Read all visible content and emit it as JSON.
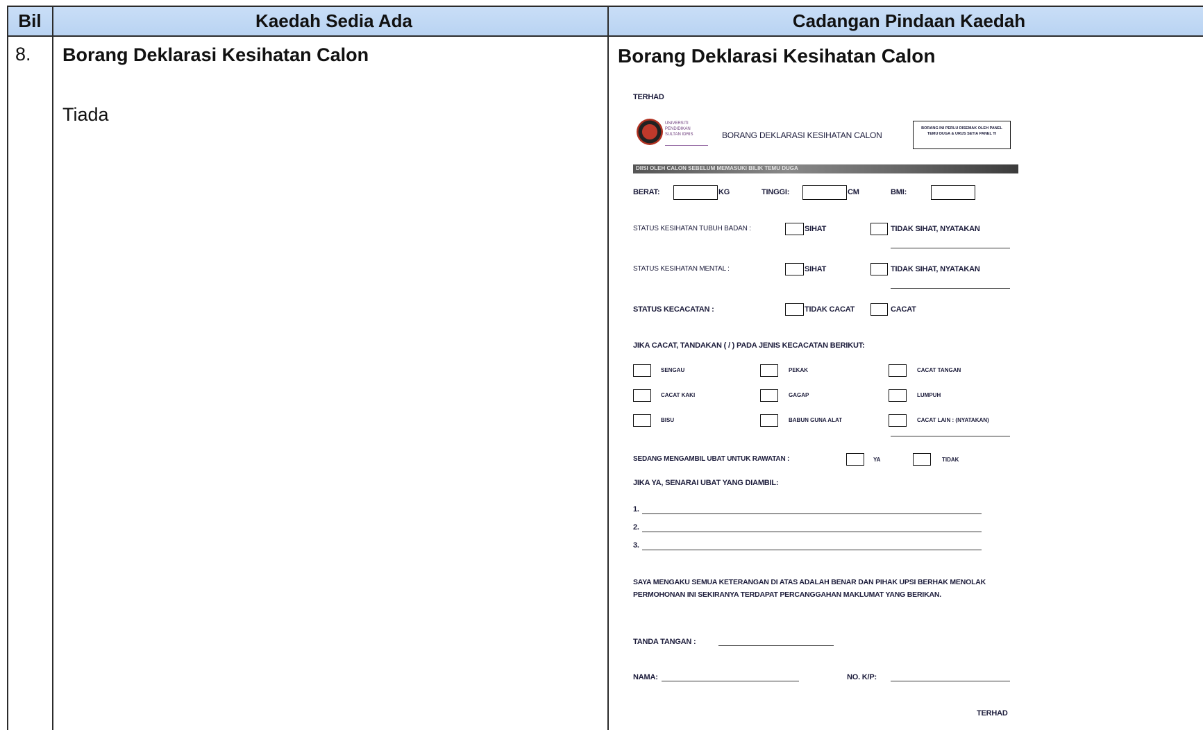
{
  "headers": {
    "bil": "Bil",
    "kaedah_sedia_ada": "Kaedah Sedia Ada",
    "cadangan": "Cadangan Pindaan Kaedah"
  },
  "row": {
    "number": "8.",
    "left_title": "Borang Deklarasi Kesihatan Calon",
    "left_body": "Tiada",
    "right_title": "Borang Deklarasi Kesihatan Calon"
  },
  "form": {
    "terhad_top": "TERHAD",
    "logo_text": "UNIVERSITI PENDIDIKAN SULTAN IDRIS",
    "form_title": "BORANG DEKLARASI KESIHATAN CALON",
    "note_box": "BORANG INI PERLU DISEMAK OLEH PANEL TEMU DUGA & URUS SETIA PANEL TI",
    "strip_text": "DIISI OLEH CALON SEBELUM MEMASUKI BILIK TEMU DUGA",
    "berat": "BERAT:",
    "kg": "KG",
    "tinggi": "TINGGI:",
    "cm": "CM",
    "bmi": "BMI:",
    "status_tubuh": "STATUS KESIHATAN TUBUH BADAN :",
    "status_mental": "STATUS KESIHATAN MENTAL :",
    "status_kecacatan": "STATUS KECACATAN :",
    "sihat": "SIHAT",
    "tidak_sihat": "TIDAK SIHAT, NYATAKAN",
    "tidak_cacat": "TIDAK CACAT",
    "cacat": "CACAT",
    "jika_cacat": "JIKA CACAT, TANDAKAN ( / ) PADA JENIS KECACATAN BERIKUT:",
    "disabilities": [
      "SENGAU",
      "PEKAK",
      "CACAT TANGAN",
      "CACAT KAKI",
      "GAGAP",
      "LUMPUH",
      "BISU",
      "BABUN GUNA ALAT",
      "CACAT LAIN : (NYATAKAN)"
    ],
    "ubat_q": "SEDANG MENGAMBIL UBAT UNTUK RAWATAN :",
    "ya": "YA",
    "tidak": "TIDAK",
    "senarai_ubat": "JIKA YA, SENARAI UBAT YANG DIAMBIL:",
    "list": [
      "1.",
      "2.",
      "3."
    ],
    "declaration_1": "SAYA MENGAKU SEMUA KETERANGAN DI ATAS ADALAH BENAR DAN PIHAK UPSI BERHAK MENOLAK",
    "declaration_2": "PERMOHONAN INI SEKIRANYA TERDAPAT PERCANGGAHAN MAKLUMAT YANG BERIKAN.",
    "tandatangan": "TANDA TANGAN :",
    "nama": "NAMA:",
    "nokp": "NO. K/P:",
    "terhad_bottom": "TERHAD"
  }
}
